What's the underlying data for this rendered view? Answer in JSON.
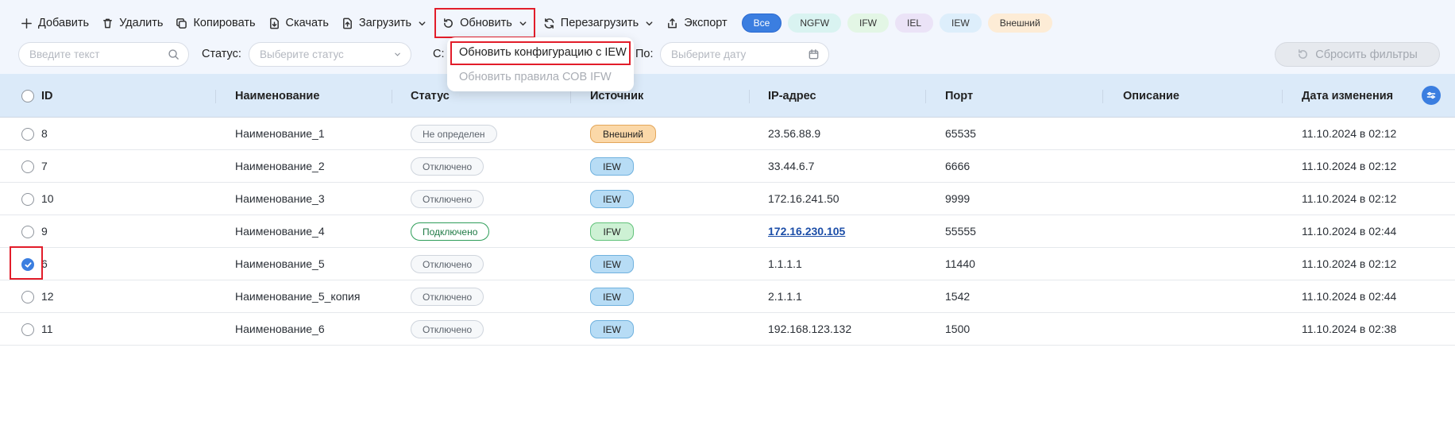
{
  "toolbar": {
    "add": "Добавить",
    "delete": "Удалить",
    "copy": "Копировать",
    "download": "Скачать",
    "upload": "Загрузить",
    "update": "Обновить",
    "reload": "Перезагрузить",
    "export": "Экспорт",
    "chips": [
      {
        "label": "Все",
        "bg": "#3b7ee0",
        "color": "#ffffff",
        "border": "#2c6ad1"
      },
      {
        "label": "NGFW",
        "bg": "#d9f3f1",
        "color": "#333333",
        "border": "#d9f3f1"
      },
      {
        "label": "IFW",
        "bg": "#e3f6e5",
        "color": "#333333",
        "border": "#e3f6e5"
      },
      {
        "label": "IEL",
        "bg": "#ebe3f7",
        "color": "#333333",
        "border": "#ebe3f7"
      },
      {
        "label": "IEW",
        "bg": "#ddeefb",
        "color": "#333333",
        "border": "#ddeefb"
      },
      {
        "label": "Внешний",
        "bg": "#fdecd6",
        "color": "#333333",
        "border": "#fdecd6"
      }
    ]
  },
  "filters": {
    "search_placeholder": "Введите текст",
    "status_label": "Статус:",
    "status_placeholder": "Выберите статус",
    "from_label": "С:",
    "to_label": "По:",
    "date_placeholder": "Выберите дату",
    "reset": "Сбросить фильтры"
  },
  "dropdown": {
    "item1": "Обновить конфигурацию с IEW",
    "item2": "Обновить правила СОВ IFW"
  },
  "table": {
    "headers": {
      "id": "ID",
      "name": "Наименование",
      "status": "Статус",
      "source": "Источник",
      "ip": "IP-адрес",
      "port": "Порт",
      "desc": "Описание",
      "date": "Дата изменения"
    },
    "rows": [
      {
        "id": "8",
        "name": "Наименование_1",
        "status": "Не определен",
        "status_type": "neutral",
        "source": "Внешний",
        "source_type": "ext",
        "ip": "23.56.88.9",
        "ip_link": false,
        "port": "65535",
        "date": "11.10.2024 в 02:12",
        "checked": false
      },
      {
        "id": "7",
        "name": "Наименование_2",
        "status": "Отключено",
        "status_type": "neutral",
        "source": "IEW",
        "source_type": "IEW",
        "ip": "33.44.6.7",
        "ip_link": false,
        "port": "6666",
        "date": "11.10.2024 в 02:12",
        "checked": false
      },
      {
        "id": "10",
        "name": "Наименование_3",
        "status": "Отключено",
        "status_type": "neutral",
        "source": "IEW",
        "source_type": "IEW",
        "ip": "172.16.241.50",
        "ip_link": false,
        "port": "9999",
        "date": "11.10.2024 в 02:12",
        "checked": false
      },
      {
        "id": "9",
        "name": "Наименование_4",
        "status": "Подключено",
        "status_type": "ok",
        "source": "IFW",
        "source_type": "IFW",
        "ip": "172.16.230.105",
        "ip_link": true,
        "port": "55555",
        "date": "11.10.2024 в 02:44",
        "checked": false
      },
      {
        "id": "6",
        "name": "Наименование_5",
        "status": "Отключено",
        "status_type": "neutral",
        "source": "IEW",
        "source_type": "IEW",
        "ip": "1.1.1.1",
        "ip_link": false,
        "port": "11440",
        "date": "11.10.2024 в 02:12",
        "checked": true
      },
      {
        "id": "12",
        "name": "Наименование_5_копия",
        "status": "Отключено",
        "status_type": "neutral",
        "source": "IEW",
        "source_type": "IEW",
        "ip": "2.1.1.1",
        "ip_link": false,
        "port": "1542",
        "date": "11.10.2024 в 02:44",
        "checked": false
      },
      {
        "id": "11",
        "name": "Наименование_6",
        "status": "Отключено",
        "status_type": "neutral",
        "source": "IEW",
        "source_type": "IEW",
        "ip": "192.168.123.132",
        "ip_link": false,
        "port": "1500",
        "date": "11.10.2024 в 02:38",
        "checked": false
      }
    ]
  }
}
